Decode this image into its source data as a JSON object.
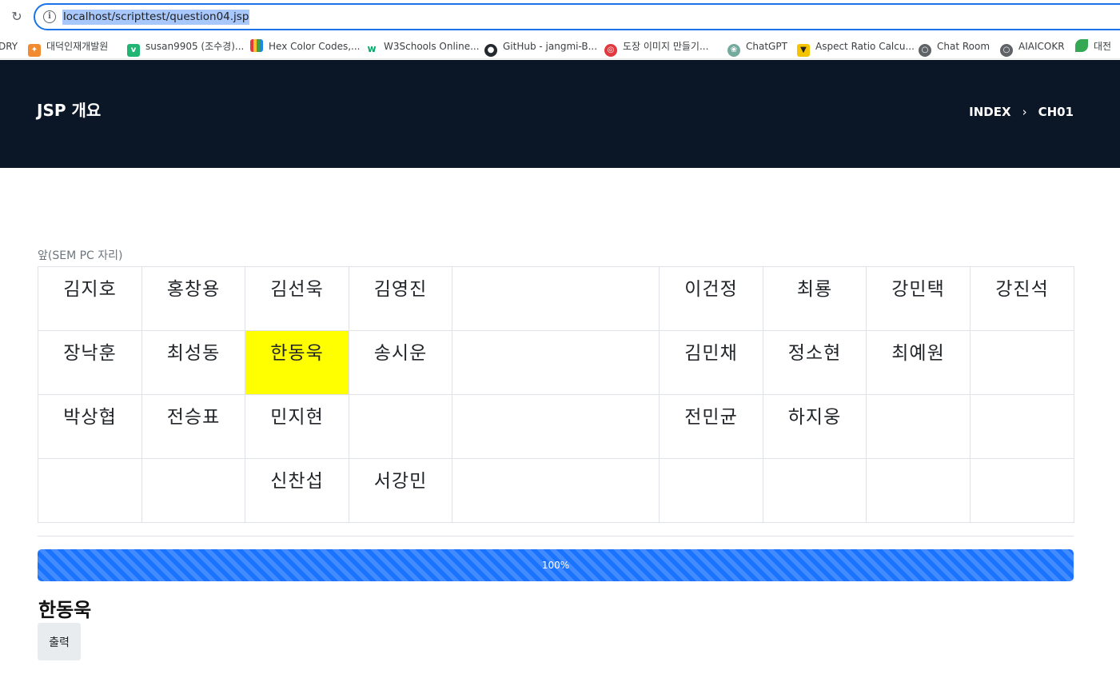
{
  "browser": {
    "url": "localhost/scripttest/question04.jsp",
    "bookmarks": [
      {
        "label": "DRY",
        "icon": "none",
        "color": "#ffffff"
      },
      {
        "label": "대덕인재개발원",
        "icon": "bird-icon",
        "color": "#f28b30"
      },
      {
        "label": "susan9905 (조수경)...",
        "icon": "v-icon",
        "color": "#21b573"
      },
      {
        "label": "Hex Color Codes,...",
        "icon": "color-bars-icon",
        "color": "#7b4bd6"
      },
      {
        "label": "W3Schools Online...",
        "icon": "w3-icon",
        "color": "#04aa6d"
      },
      {
        "label": "GitHub - jangmi-B...",
        "icon": "github-icon",
        "color": "#24292f"
      },
      {
        "label": "도장 이미지 만들기...",
        "icon": "stamp-icon",
        "color": "#e0393e"
      },
      {
        "label": "ChatGPT",
        "icon": "chatgpt-icon",
        "color": "#74aa9c"
      },
      {
        "label": "Aspect Ratio Calcu...",
        "icon": "aspect-ratio-icon",
        "color": "#f5c400"
      },
      {
        "label": "Chat Room",
        "icon": "globe-icon",
        "color": "#5f6368"
      },
      {
        "label": "AIAICOKR",
        "icon": "globe-icon",
        "color": "#5f6368"
      },
      {
        "label": "대전 ",
        "icon": "leaf-icon",
        "color": "#34a853"
      }
    ]
  },
  "header": {
    "title": "JSP 개요",
    "breadcrumb": [
      "INDEX",
      "CH01"
    ],
    "separator": "›"
  },
  "seating": {
    "front_label": "앞(SEM PC 자리)",
    "rows": [
      [
        "김지호",
        "홍창용",
        "김선욱",
        "김영진",
        "",
        "이건정",
        "최룡",
        "강민택",
        "강진석"
      ],
      [
        "장낙훈",
        "최성동",
        "한동욱",
        "송시운",
        "",
        "김민채",
        "정소현",
        "최예원",
        ""
      ],
      [
        "박상협",
        "전승표",
        "민지현",
        "",
        "",
        "전민균",
        "하지웅",
        "",
        ""
      ],
      [
        "",
        "",
        "신찬섭",
        "서강민",
        "",
        "",
        "",
        "",
        ""
      ]
    ],
    "highlight": {
      "row": 1,
      "col": 2,
      "color": "#ffff00"
    }
  },
  "progress": {
    "value": 100,
    "label": "100%"
  },
  "result": {
    "name": "한동욱"
  },
  "print_button": {
    "label": "출력"
  },
  "colors": {
    "header_bg": "#0b1727",
    "progress": "#1a73ff",
    "highlight": "#ffff00"
  }
}
